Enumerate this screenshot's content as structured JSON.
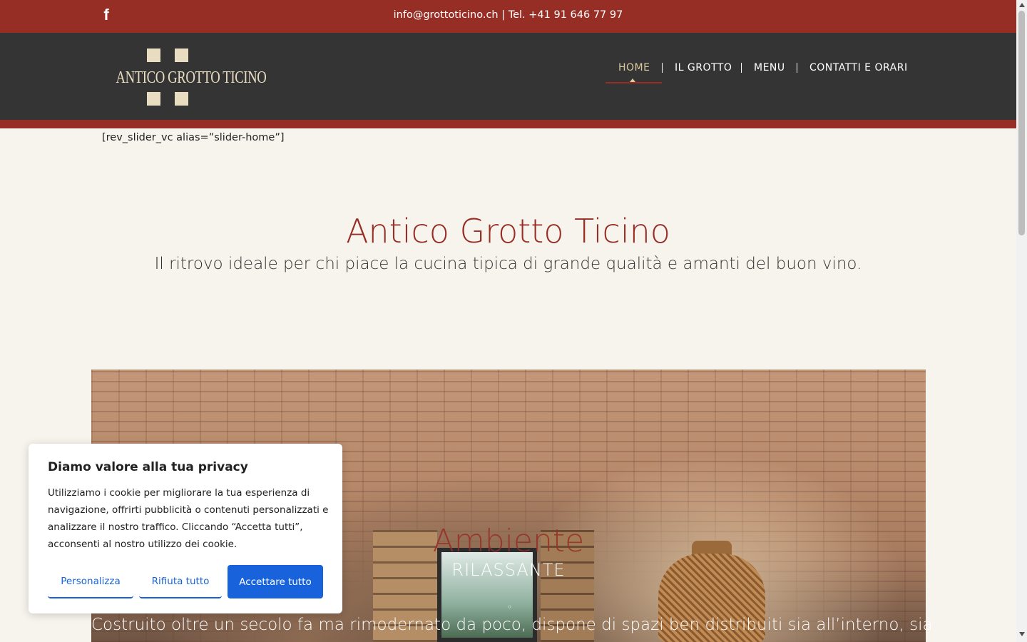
{
  "topbar": {
    "contact": "info@grottoticino.ch | Tel. +41 91 646 77 97"
  },
  "logo": {
    "text": "ANTICO GROTTO TICINO"
  },
  "nav": {
    "items": [
      {
        "label": "HOME"
      },
      {
        "label": "IL GROTTO"
      },
      {
        "label": "MENU"
      },
      {
        "label": "CONTATTI E ORARI"
      }
    ]
  },
  "content": {
    "shortcode": "[rev_slider_vc alias=”slider-home”]",
    "title": "Antico Grotto Ticino",
    "subtitle": "Il ritrovo ideale per chi piace la cucina tipica di grande qualità e amanti del buon vino."
  },
  "slide": {
    "title": "Ambiente",
    "subtitle": "RILASSANTE",
    "text": "Costruito oltre un secolo fa ma rimodernato da poco, dispone di spazi ben distribuiti sia all’interno, sia"
  },
  "cookie": {
    "title": "Diamo valore alla tua privacy",
    "body": "Utilizziamo i cookie per migliorare la tua esperienza di navigazione, offrirti pubblicità o contenuti personalizzati e analizzare il nostro traffico. Cliccando “Accetta tutti”, acconsenti al nostro utilizzo dei cookie.",
    "customize": "Personalizza",
    "reject": "Rifiuta tutto",
    "accept": "Accettare tutto"
  },
  "colors": {
    "brand_red": "#962e25",
    "header_dark": "#343434",
    "gold": "#dcc99e",
    "cookie_blue": "#1863dc"
  },
  "icons": [
    "facebook-icon"
  ]
}
